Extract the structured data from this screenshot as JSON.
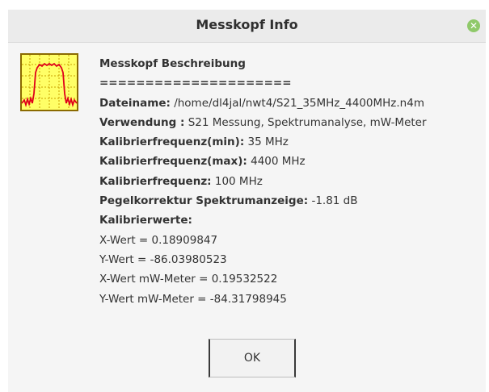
{
  "window": {
    "title": "Messkopf Info",
    "close_icon": "close-icon"
  },
  "icon": {
    "name": "probe-frequency-response-icon",
    "colors": {
      "background": "#ffff66",
      "trace": "#e0001b",
      "grid": "#c8a000"
    }
  },
  "info": {
    "heading": "Messkopf Beschreibung",
    "separator": "=====================",
    "dateiname_label": "Dateiname:",
    "dateiname_value": " /home/dl4jal/nwt4/S21_35MHz_4400MHz.n4m",
    "verwendung_label": "Verwendung :",
    "verwendung_value": " S21 Messung, Spektrumanalyse, mW-Meter",
    "kal_min_label": "Kalibrierfrequenz(min):",
    "kal_min_value": " 35 MHz",
    "kal_max_label": "Kalibrierfrequenz(max):",
    "kal_max_value": " 4400 MHz",
    "kal_label": "Kalibrierfrequenz:",
    "kal_value": " 100 MHz",
    "pegel_label": "Pegelkorrektur Spektrumanzeige:",
    "pegel_value": " -1.81 dB",
    "kalibrierwerte_label": "Kalibrierwerte:",
    "x_wert": "X-Wert = 0.18909847",
    "y_wert": "Y-Wert = -86.03980523",
    "x_wert_mw": "X-Wert mW-Meter = 0.19532522",
    "y_wert_mw": "Y-Wert mW-Meter = -84.31798945"
  },
  "buttons": {
    "ok_label": "OK"
  }
}
